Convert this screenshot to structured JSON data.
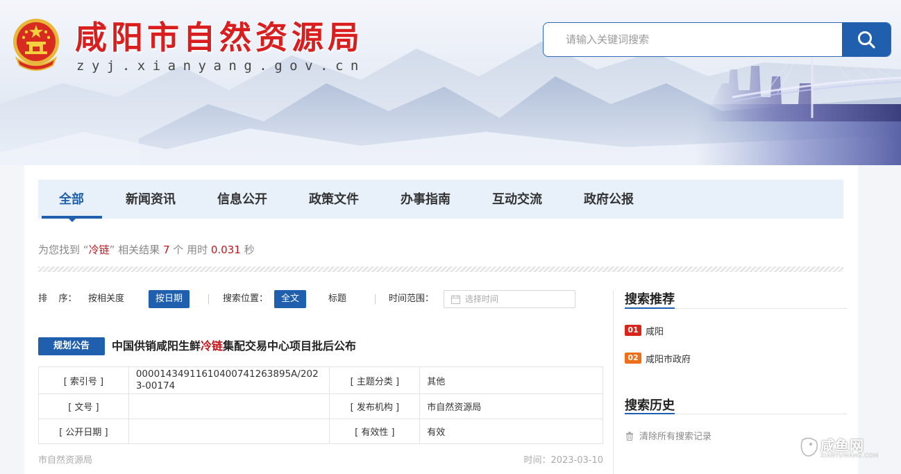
{
  "header": {
    "site_title": "咸阳市自然资源局",
    "site_domain": "zyj.xianyang.gov.cn",
    "search_placeholder": "请输入关键词搜索"
  },
  "tabs": [
    {
      "label": "全部",
      "active": true
    },
    {
      "label": "新闻资讯",
      "active": false
    },
    {
      "label": "信息公开",
      "active": false
    },
    {
      "label": "政策文件",
      "active": false
    },
    {
      "label": "办事指南",
      "active": false
    },
    {
      "label": "互动交流",
      "active": false
    },
    {
      "label": "政府公报",
      "active": false
    }
  ],
  "summary": {
    "prefix": "为您找到",
    "quote_open": "“",
    "keyword": "冷链",
    "quote_close": "”",
    "middle": "相关结果",
    "count": "7",
    "unit": "个",
    "time_label": "用时",
    "seconds": "0.031",
    "seconds_unit": "秒"
  },
  "filters": {
    "sort_label": "排    序：",
    "sort_relevance": "按相关度",
    "sort_date": "按日期",
    "position_label": "搜索位置：",
    "position_full": "全文",
    "position_title": "标题",
    "time_label": "时间范围：",
    "time_placeholder": "选择时间"
  },
  "result": {
    "tag": "规划公告",
    "title_before": "中国供销咸阳生鲜",
    "title_highlight": "冷链",
    "title_after": "集配交易中心项目批后公布",
    "meta": {
      "index_key": "[ 索引号 ]",
      "index_val": "00001434911610400741263895A/2023-00174",
      "topic_key": "[ 主题分类 ]",
      "topic_val": "其他",
      "doc_key": "[ 文号 ]",
      "doc_val": "",
      "org_key": "[ 发布机构 ]",
      "org_val": "市自然资源局",
      "date_key": "[ 公开日期 ]",
      "date_val": "",
      "valid_key": "[ 有效性 ]",
      "valid_val": "有效"
    },
    "source": "市自然资源局",
    "time": "时间：2023-03-10"
  },
  "sidebar": {
    "recommend_title": "搜索推荐",
    "recommendations": [
      {
        "rank": "01",
        "text": "咸阳",
        "color": "#d8261d"
      },
      {
        "rank": "02",
        "text": "咸阳市政府",
        "color": "#ef6e1a"
      }
    ],
    "history_title": "搜索历史",
    "clear_history": "清除所有搜索记录"
  },
  "watermark": {
    "text": "咸鱼网",
    "sub": "XIANYUWANG.COM"
  },
  "colors": {
    "brand_blue": "#1f5fad",
    "title_red": "#d81e1e",
    "highlight_red": "#c4161c"
  }
}
